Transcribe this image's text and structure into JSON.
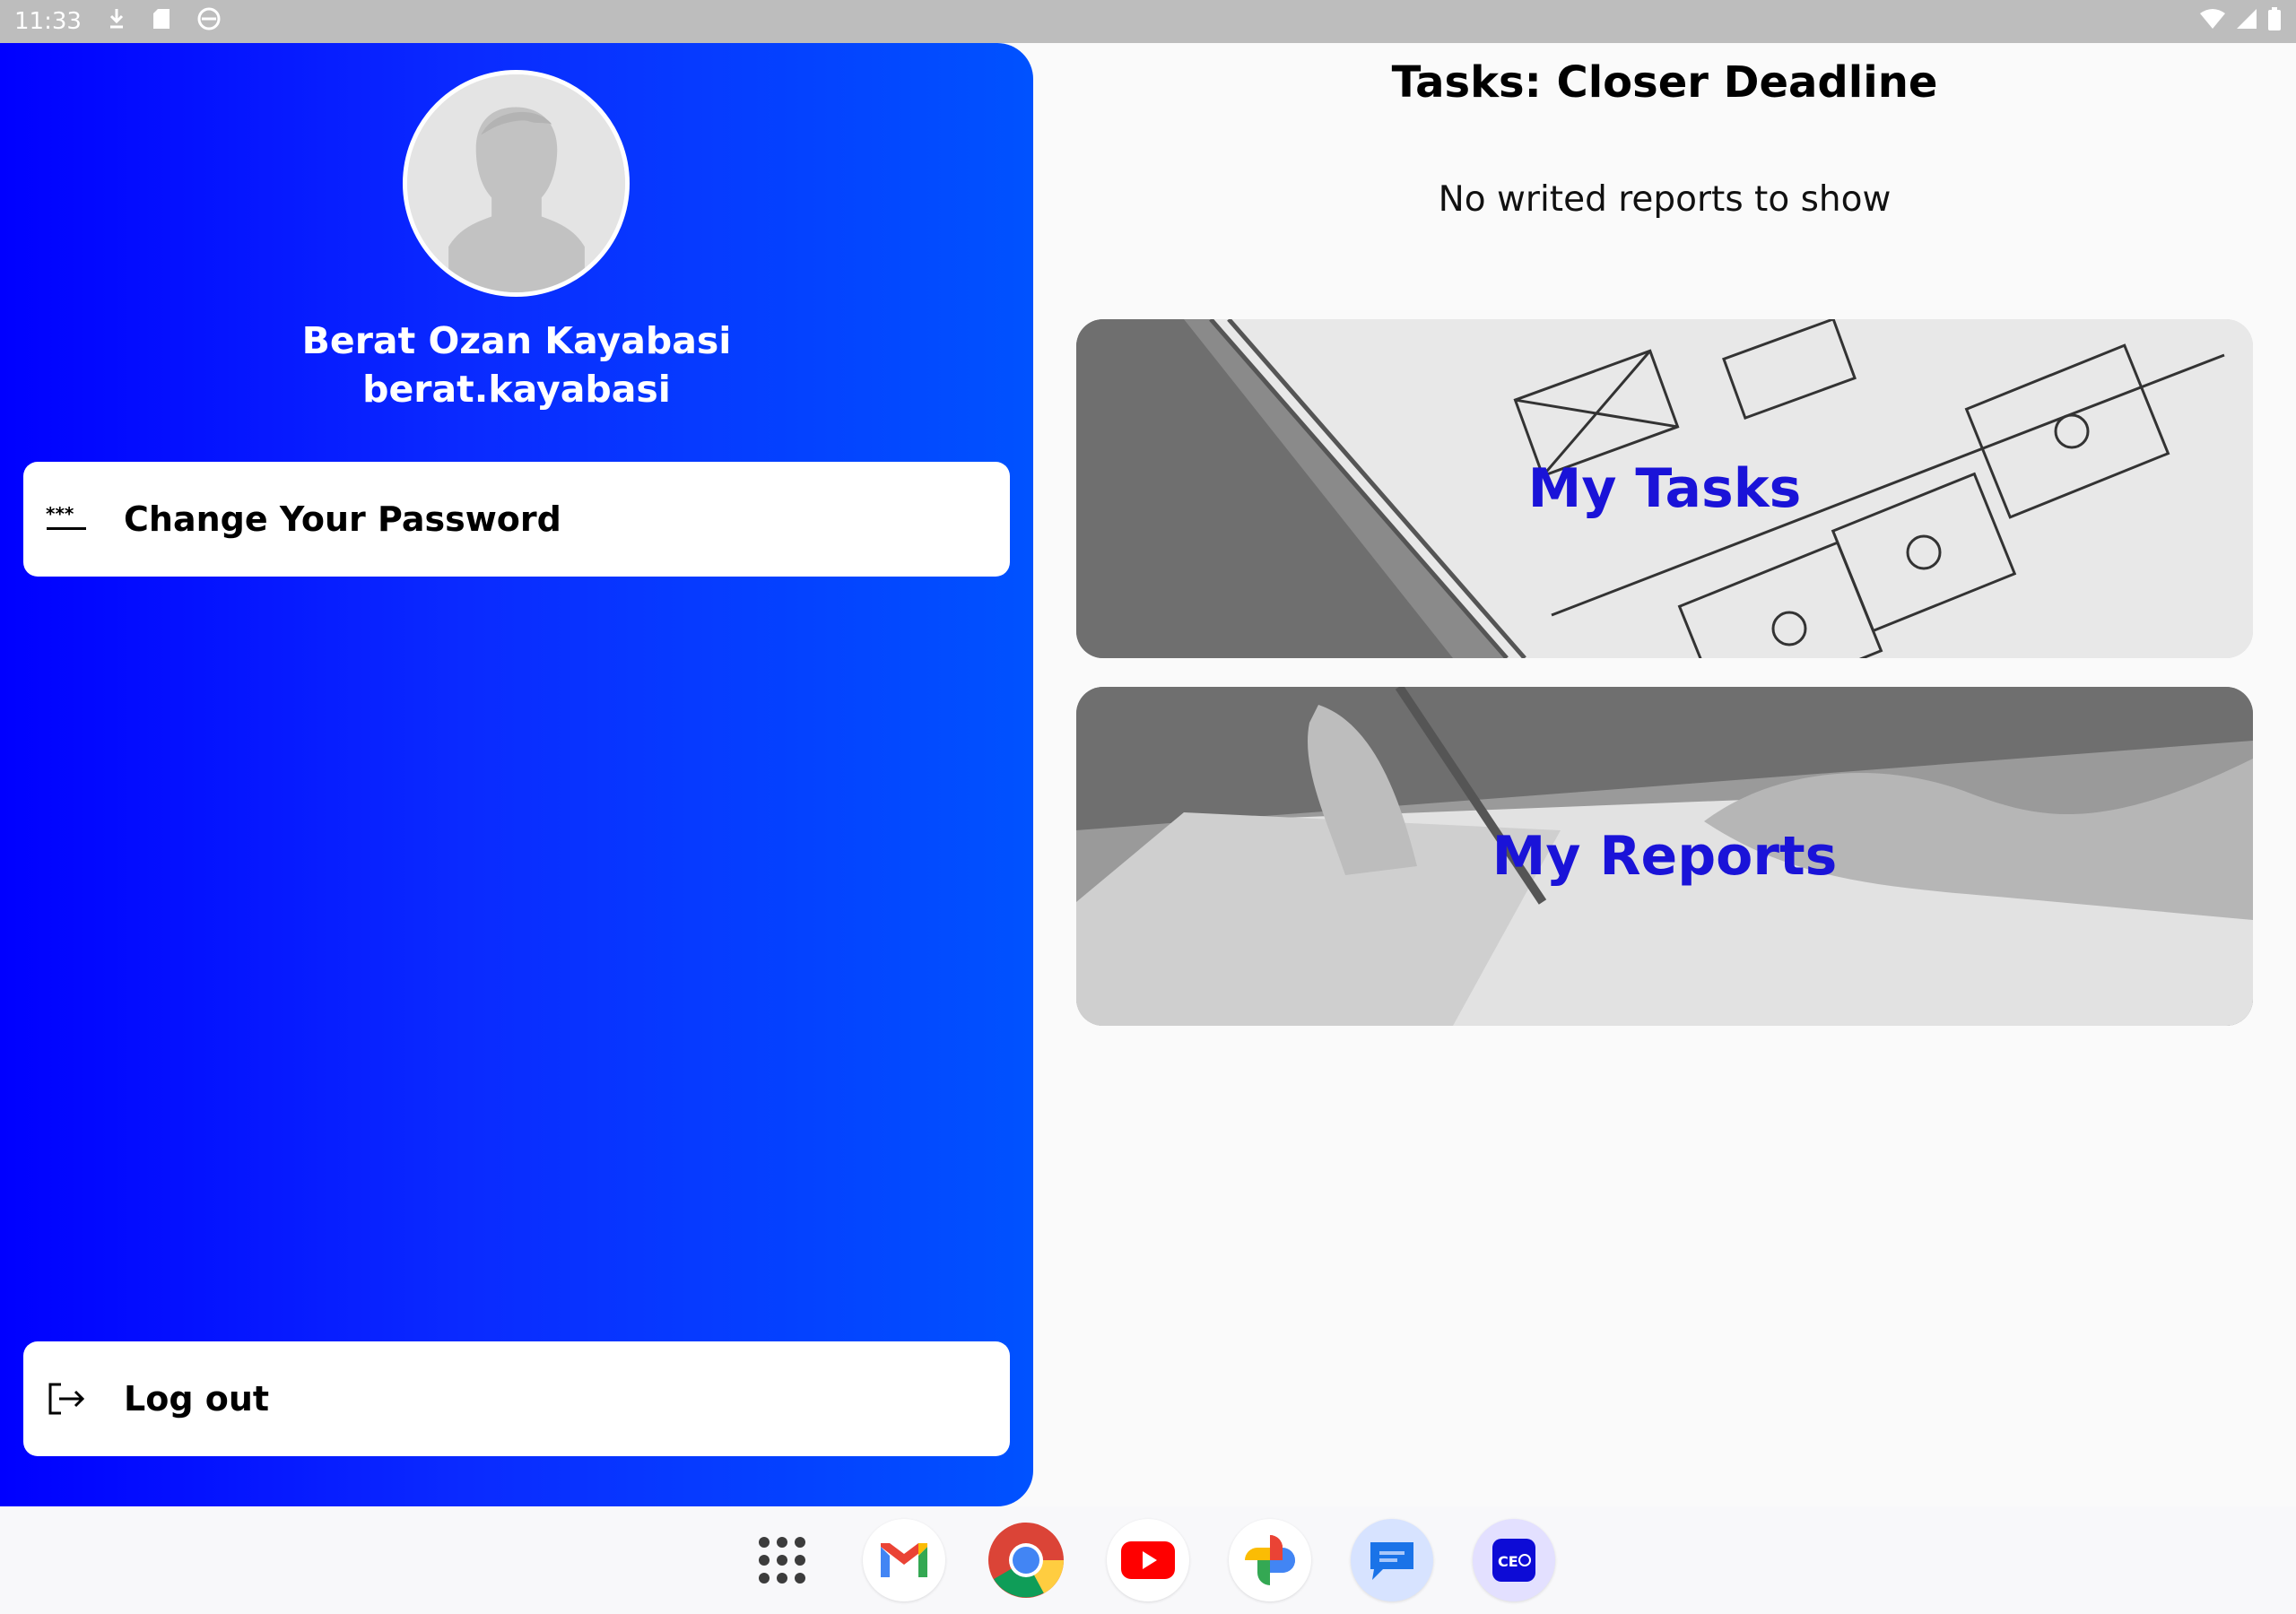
{
  "status_bar": {
    "time": "11:33",
    "left_icons": [
      "download-icon",
      "sd-card-icon",
      "sync-icon"
    ],
    "right_icons": [
      "wifi-icon",
      "cellular-signal-icon",
      "battery-icon"
    ]
  },
  "drawer": {
    "user": {
      "full_name": "Berat Ozan Kayabasi",
      "username": "berat.kayabasi",
      "avatar_icon": "profile-placeholder-icon"
    },
    "buttons": {
      "change_password": {
        "label": "Change Your Password",
        "icon": "password-icon"
      },
      "logout": {
        "label": "Log out",
        "icon": "logout-icon"
      }
    },
    "gradient": [
      "#0000ff",
      "#0052ff"
    ]
  },
  "main": {
    "title": "Tasks: Closer Deadline",
    "empty_message": "No writed reports to show",
    "cards": {
      "tasks": {
        "label": "My Tasks"
      },
      "reports": {
        "label": "My Reports"
      }
    },
    "card_label_color": "#1a13d8"
  },
  "dock": {
    "apps": [
      "app-drawer-icon",
      "gmail-icon",
      "chrome-icon",
      "youtube-icon",
      "photos-icon",
      "messages-icon",
      "ce-app-icon"
    ]
  }
}
